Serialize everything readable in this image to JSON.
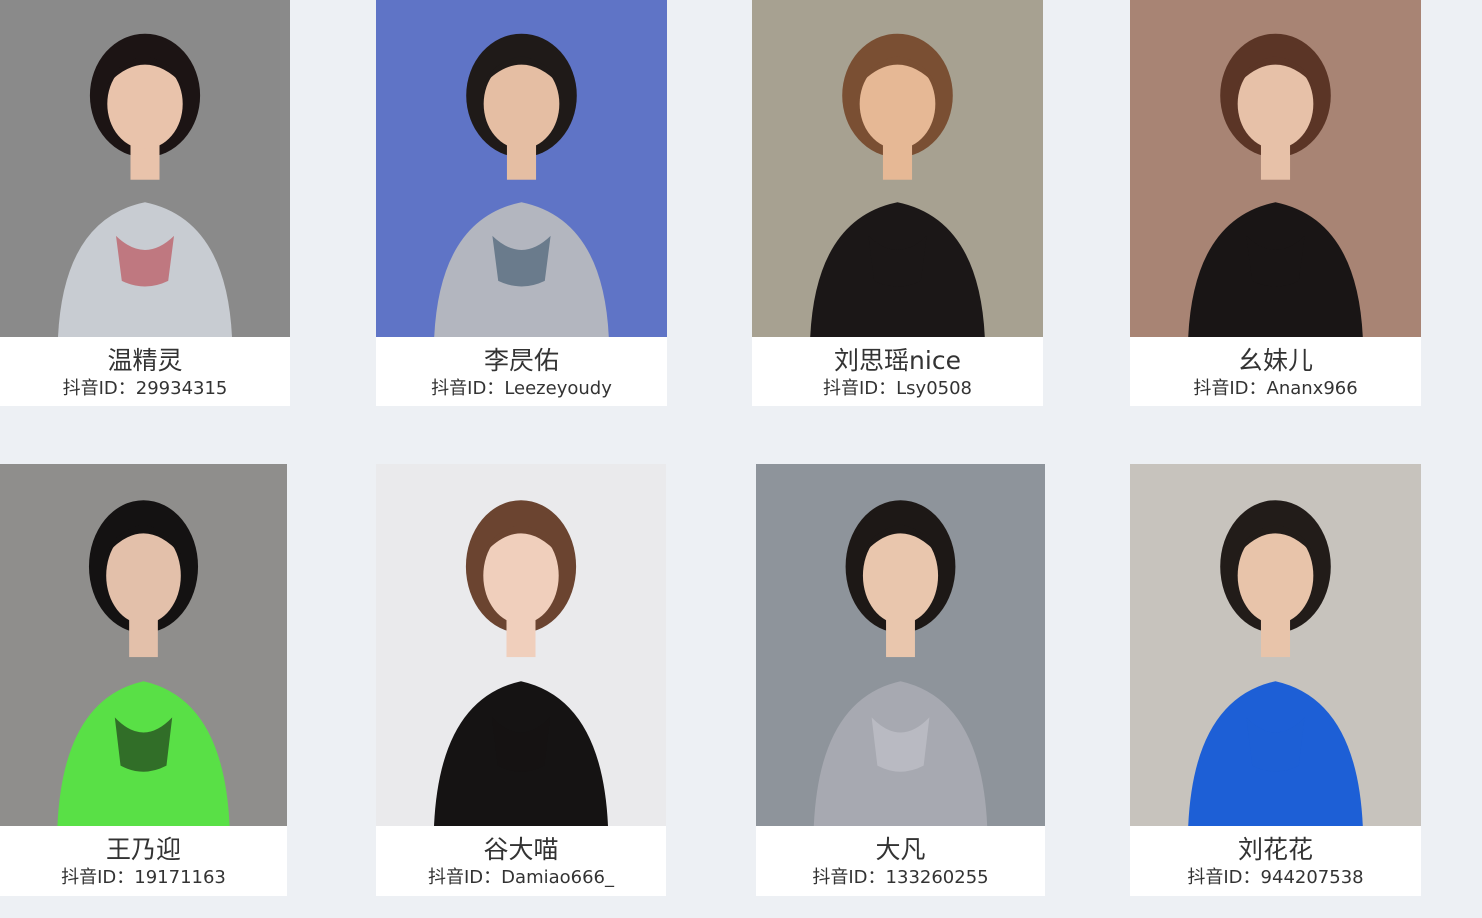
{
  "id_prefix": "抖音ID：",
  "creators": [
    {
      "name": "温精灵",
      "douyin_id": "29934315",
      "bg": "#8a8a8a",
      "skin": "#e9c3ab",
      "hair": "#1c1414",
      "outfit": "#c8ccd2",
      "accent": "#b8333c"
    },
    {
      "name": "李昃佑",
      "douyin_id": "Leezeyoudy",
      "bg": "#5f74c6",
      "skin": "#e5bea3",
      "hair": "#1f1a18",
      "outfit": "#b3b6bf",
      "accent": "#2e4a62"
    },
    {
      "name": "刘思瑶nice",
      "douyin_id": "Lsy0508",
      "bg": "#a7a191",
      "skin": "#e6b895",
      "hair": "#7a4f33",
      "outfit": "#1b1717",
      "accent": "#1b1717"
    },
    {
      "name": "幺妹儿",
      "douyin_id": "Ananx966",
      "bg": "#a88474",
      "skin": "#e7c1a8",
      "hair": "#5b3526",
      "outfit": "#191515",
      "accent": "#191515"
    },
    {
      "name": "王乃迎",
      "douyin_id": "19171163",
      "bg": "#8f8e8c",
      "skin": "#e3c0aa",
      "hair": "#141212",
      "outfit": "#59e046",
      "accent": "#101010"
    },
    {
      "name": "谷大喵",
      "douyin_id": "Damiao666_",
      "bg": "#eaeaec",
      "skin": "#f0cfbc",
      "hair": "#6b4430",
      "outfit": "#151313",
      "accent": "#151313"
    },
    {
      "name": "大凡",
      "douyin_id": "133260255",
      "bg": "#8e949b",
      "skin": "#e9c6ad",
      "hair": "#1d1816",
      "outfit": "#a7a9b1",
      "accent": "#c8c9d0"
    },
    {
      "name": "刘花花",
      "douyin_id": "944207538",
      "bg": "#c7c3bd",
      "skin": "#e8c4aa",
      "hair": "#221c19",
      "outfit": "#1d5fd6",
      "accent": "#1d5fd6"
    }
  ]
}
